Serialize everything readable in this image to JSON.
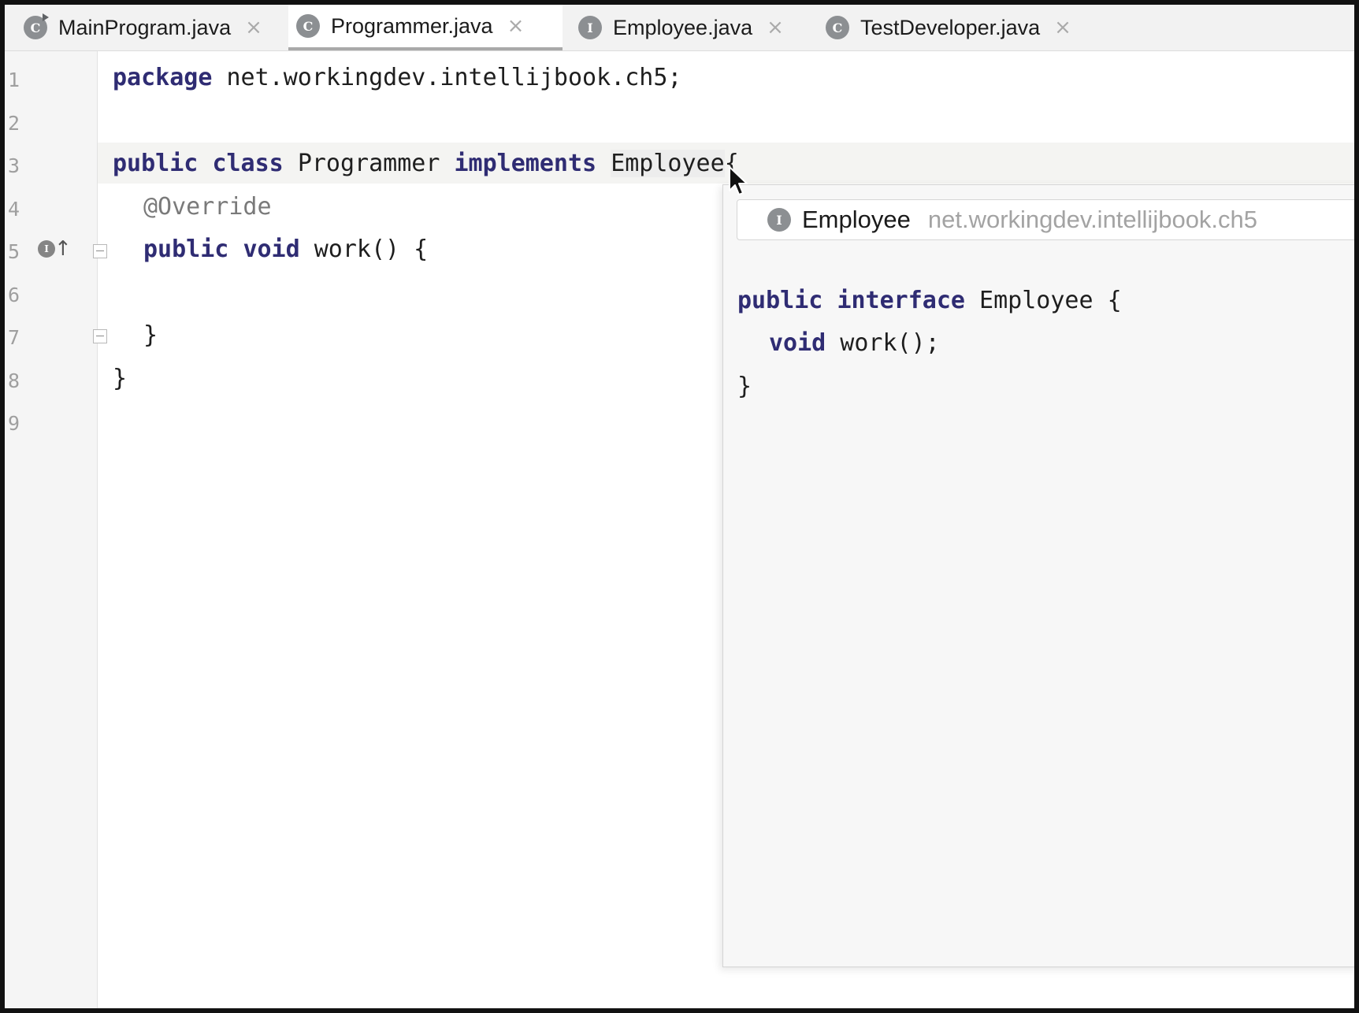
{
  "tabs": [
    {
      "icon": "C",
      "label": "MainProgram.java",
      "active": false
    },
    {
      "icon": "C",
      "label": "Programmer.java",
      "active": true
    },
    {
      "icon": "I",
      "label": "Employee.java",
      "active": false
    },
    {
      "icon": "C",
      "label": "TestDeveloper.java",
      "active": false
    }
  ],
  "tab_close_glyph": "×",
  "line_numbers": [
    "1",
    "2",
    "3",
    "4",
    "5",
    "6",
    "7",
    "8",
    "9"
  ],
  "gutter": {
    "implements_badge": "I",
    "implements_arrow": "↑"
  },
  "code": {
    "l1_kw": "package",
    "l1_rest": " net.workingdev.intellijbook.ch5;",
    "l3_kw1": "public",
    "l3_kw2": "class",
    "l3_name": "Programmer",
    "l3_kw3": "implements",
    "l3_iface": "Employee",
    "l3_brace": "{",
    "l4_anno": "@Override",
    "l5_kw1": "public",
    "l5_kw2": "void",
    "l5_rest": " work() {",
    "l7_brace": "}",
    "l8_brace": "}"
  },
  "popup": {
    "icon": "I",
    "name": "Employee",
    "package": "net.workingdev.intellijbook.ch5",
    "p1_kw1": "public",
    "p1_kw2": "interface",
    "p1_rest": " Employee {",
    "p2_kw": "void",
    "p2_rest": " work();",
    "p3_brace": "}"
  },
  "colors": {
    "keyword": "#2f2c73",
    "annotation": "#7a7a7a",
    "icon_bg": "#8c8f92"
  }
}
